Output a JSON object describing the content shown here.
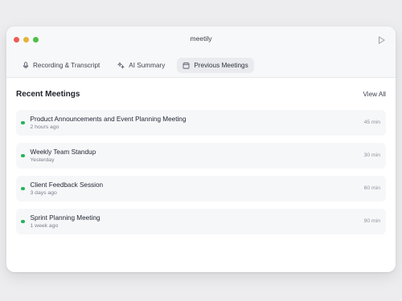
{
  "window": {
    "title": "meetily"
  },
  "tabs": [
    {
      "label": "Recording & Transcript",
      "icon": "microphone-icon",
      "active": false
    },
    {
      "label": "AI Summary",
      "icon": "sparkle-icon",
      "active": false
    },
    {
      "label": "Previous Meetings",
      "icon": "calendar-icon",
      "active": true
    }
  ],
  "section": {
    "title": "Recent Meetings",
    "view_all": "View All"
  },
  "meetings": [
    {
      "title": "Product Announcements and Event Planning Meeting",
      "time": "2 hours ago",
      "duration": "45 min",
      "status": "green"
    },
    {
      "title": "Weekly Team Standup",
      "time": "Yesterday",
      "duration": "30 min",
      "status": "green"
    },
    {
      "title": "Client Feedback Session",
      "time": "3 days ago",
      "duration": "60 min",
      "status": "green"
    },
    {
      "title": "Sprint Planning Meeting",
      "time": "1 week ago",
      "duration": "90 min",
      "status": "green"
    }
  ],
  "colors": {
    "status_green": "#27b35a",
    "traffic_red": "#ec5b56",
    "traffic_yellow": "#e6b33a",
    "traffic_green": "#4fbf48"
  }
}
